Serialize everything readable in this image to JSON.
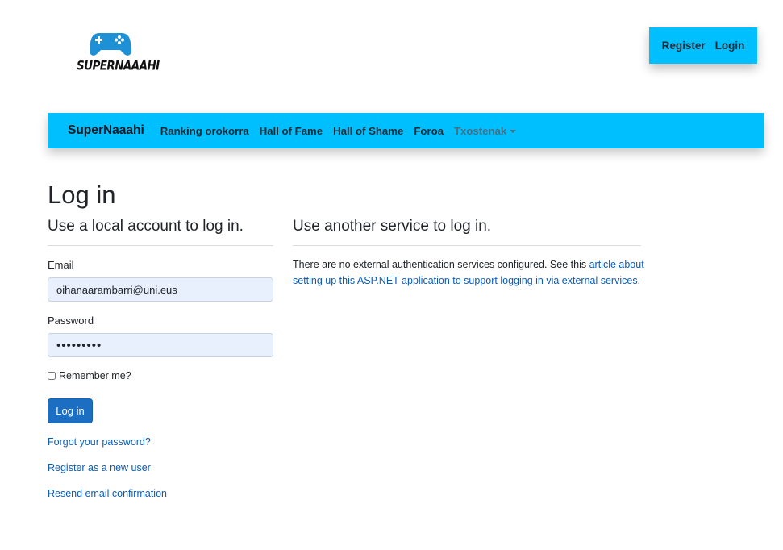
{
  "logo": {
    "text": "SUPERNAAAHI",
    "icon": "gamepad-icon",
    "color": "#1e90d6"
  },
  "auth": {
    "register": "Register",
    "login": "Login"
  },
  "navbar": {
    "brand": "SuperNaaahi",
    "items": [
      {
        "label": "Ranking orokorra"
      },
      {
        "label": "Hall of Fame"
      },
      {
        "label": "Hall of Shame"
      },
      {
        "label": "Foroa"
      }
    ],
    "dropdown": "Txostenak",
    "background": "#00bfff"
  },
  "page": {
    "title": "Log in",
    "left_title": "Use a local account to log in.",
    "right_title": "Use another service to log in."
  },
  "form": {
    "email_label": "Email",
    "email_value": "oihanaarambarri@uni.eus",
    "password_label": "Password",
    "password_value": "•••••••••",
    "remember_label": "Remember me?",
    "submit": "Log in",
    "forgot": "Forgot your password?",
    "register": "Register as a new user",
    "resend": "Resend email confirmation"
  },
  "external": {
    "text": "There are no external authentication services configured. See this ",
    "link": "article about setting up this ASP.NET application to support logging in via external services",
    "suffix": "."
  },
  "colors": {
    "primary_button": "#1b6ec2",
    "link": "#0d5cb6",
    "input_bg": "#e8f0fe"
  }
}
